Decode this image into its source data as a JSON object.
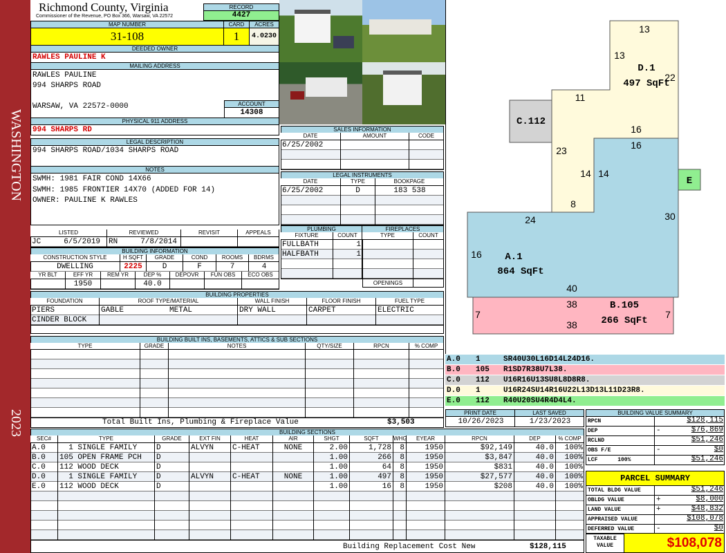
{
  "band": {
    "district": "WASHINGTON",
    "year": "2023"
  },
  "header": {
    "county": "Richmond County, Virginia",
    "subtitle": "Commissioner of the Revenue, PO Box 366, Warsaw, VA 22572",
    "record_label": "RECORD",
    "record": "4427"
  },
  "parcel": {
    "map_label": "MAP NUMBER",
    "map": "31-108",
    "card_label": "CARD",
    "card": "1",
    "acres_label": "ACRES",
    "acres": "4.0230"
  },
  "owner": {
    "label": "DEEDED OWNER",
    "name": "RAWLES PAULINE K"
  },
  "mailing": {
    "label": "MAILING ADDRESS",
    "line1": "RAWLES PAULINE",
    "line2": "994 SHARPS ROAD",
    "line3": "WARSAW, VA 22572-0000",
    "account_label": "ACCOUNT",
    "account": "14308"
  },
  "physical": {
    "label": "PHYSICAL 911 ADDRESS",
    "value": "994 SHARPS RD"
  },
  "legal": {
    "label": "LEGAL DESCRIPTION",
    "value": "994 SHARPS ROAD/1034 SHARPS ROAD"
  },
  "notes": {
    "label": "NOTES",
    "lines": [
      "SWMH: 1981 FAIR COND 14X66",
      "SWMH: 1985 FRONTIER 14X70 (ADDED FOR 14)",
      "OWNER: PAULINE K RAWLES"
    ]
  },
  "review": {
    "headers": [
      "LISTED",
      "REVIEWED",
      "REVISIT",
      "APPEALS"
    ],
    "rows": [
      [
        "JC     6/5/2019",
        "RN     7/8/2014",
        "",
        ""
      ]
    ]
  },
  "building_info": {
    "label": "BUILDING INFORMATION",
    "headers1": [
      "CONSTRUCTION STYLE",
      "H SQFT",
      "GRADE",
      "COND",
      "ROOMS",
      "BDRMS"
    ],
    "row1": [
      [
        "DWELLING",
        "2225",
        "D",
        "F",
        "7",
        "4"
      ]
    ],
    "headers2": [
      "YR BLT",
      "EFF YR",
      "REM YR",
      "DEP %",
      "DEPOVR",
      "FUN OBS",
      "ECO OBS"
    ],
    "row2": [
      [
        "",
        "1950",
        "",
        "40.0",
        "",
        "",
        ""
      ]
    ]
  },
  "sales": {
    "label": "SALES INFORMATION",
    "headers": [
      "DATE",
      "AMOUNT",
      "CODE"
    ],
    "rows": [
      [
        "6/25/2002",
        "",
        ""
      ],
      [
        "",
        "",
        ""
      ],
      [
        "",
        "",
        ""
      ]
    ]
  },
  "instruments": {
    "label": "LEGAL INSTRUMENTS",
    "headers": [
      "DATE",
      "TYPE",
      "BOOKPAGE"
    ],
    "rows": [
      [
        "6/25/2002",
        "D",
        "183 538"
      ],
      [
        "",
        "",
        ""
      ],
      [
        "",
        "",
        ""
      ],
      [
        "",
        "",
        ""
      ]
    ]
  },
  "plumbing": {
    "label": "PLUMBING",
    "headers": [
      "FIXTURE",
      "COUNT"
    ],
    "rows": [
      [
        "FULLBATH",
        "1"
      ],
      [
        "HALFBATH",
        "1"
      ],
      [
        "",
        ""
      ],
      [
        "",
        ""
      ]
    ]
  },
  "fireplaces": {
    "label": "FIREPLACES",
    "headers": [
      "TYPE",
      "COUNT"
    ],
    "rows": [
      [
        "",
        ""
      ],
      [
        "",
        ""
      ],
      [
        "",
        ""
      ],
      [
        "",
        ""
      ]
    ],
    "openings_label": "OPENINGS"
  },
  "properties": {
    "label": "BUILDING PROPERTIES",
    "headers": [
      "FOUNDATION",
      "ROOF TYPE/MATERIAL",
      "WALL FINISH",
      "FLOOR FINISH",
      "FUEL TYPE"
    ],
    "rows": [
      [
        "PIERS",
        "GABLE          METAL",
        "DRY WALL",
        "CARPET",
        "ELECTRIC"
      ],
      [
        "CINDER BLOCK",
        "",
        "",
        "",
        ""
      ]
    ]
  },
  "builtins": {
    "label": "BUILDING BUILT INS, BASEMENTS, ATTICS & SUB SECTIONS",
    "headers": [
      "TYPE",
      "GRADE",
      "NOTES",
      "QTY/SIZE",
      "RPCN",
      "% COMP"
    ],
    "rows": [
      [
        "",
        "",
        "",
        "",
        "",
        ""
      ],
      [
        "",
        "",
        "",
        "",
        "",
        ""
      ],
      [
        "",
        "",
        "",
        "",
        "",
        ""
      ],
      [
        "",
        "",
        "",
        "",
        "",
        ""
      ],
      [
        "",
        "",
        "",
        "",
        "",
        ""
      ],
      [
        "",
        "",
        "",
        "",
        "",
        ""
      ],
      [
        "",
        "",
        "",
        "",
        "",
        ""
      ]
    ],
    "total_label": "Total Built Ins, Plumbing & Fireplace Value",
    "total": "$3,503"
  },
  "sections": {
    "label": "BUILDING SECTIONS",
    "headers": [
      "SEC#",
      "TYPE",
      "GRADE",
      "EXT FIN",
      "HEAT",
      "AIR",
      "SHGT",
      "SQFT",
      "WHGT",
      "EYEAR",
      "RPCN",
      "DEP",
      "% COMP"
    ],
    "rows": [
      [
        "A.0",
        "  1 SINGLE FAMILY",
        "D",
        "ALVYN",
        "C-HEAT",
        "NONE",
        "2.00",
        "1,728",
        "8",
        "1950",
        "$92,149",
        "40.0",
        "100%"
      ],
      [
        "B.0",
        "105 OPEN FRAME PCH",
        "D",
        "",
        "",
        "",
        "1.00",
        "266",
        "8",
        "1950",
        "$3,847",
        "40.0",
        "100%"
      ],
      [
        "C.0",
        "112 WOOD DECK",
        "D",
        "",
        "",
        "",
        "1.00",
        "64",
        "8",
        "1950",
        "$831",
        "40.0",
        "100%"
      ],
      [
        "D.0",
        "  1 SINGLE FAMILY",
        "D",
        "ALVYN",
        "C-HEAT",
        "NONE",
        "1.00",
        "497",
        "8",
        "1950",
        "$27,577",
        "40.0",
        "100%"
      ],
      [
        "E.0",
        "112 WOOD DECK",
        "D",
        "",
        "",
        "",
        "1.00",
        "16",
        "8",
        "1950",
        "$208",
        "40.0",
        "100%"
      ],
      [
        "",
        "",
        "",
        "",
        "",
        "",
        "",
        "",
        "",
        "",
        "",
        "",
        ""
      ],
      [
        "",
        "",
        "",
        "",
        "",
        "",
        "",
        "",
        "",
        "",
        "",
        "",
        ""
      ],
      [
        "",
        "",
        "",
        "",
        "",
        "",
        "",
        "",
        "",
        "",
        "",
        "",
        ""
      ],
      [
        "",
        "",
        "",
        "",
        "",
        "",
        "",
        "",
        "",
        "",
        "",
        "",
        ""
      ],
      [
        "",
        "",
        "",
        "",
        "",
        "",
        "",
        "",
        "",
        "",
        "",
        "",
        ""
      ]
    ],
    "total_label": "Building Replacement Cost New",
    "total": "$128,115"
  },
  "sketch": {
    "A": {
      "name": "A.1",
      "area": "864 SqFt",
      "dims": [
        "16",
        "14",
        "24",
        "30",
        "16",
        "40"
      ]
    },
    "B": {
      "name": "B.105",
      "area": "266 SqFt",
      "dims": [
        "38",
        "38",
        "7",
        "7"
      ]
    },
    "C": {
      "name": "C.112"
    },
    "D": {
      "name": "D.1",
      "area": "497 SqFt",
      "dims": [
        "13",
        "13",
        "22",
        "11",
        "16",
        "23",
        "14",
        "8"
      ]
    },
    "E": {
      "name": "E"
    },
    "colors": {
      "A": "#add8e6",
      "B": "#ffb6c1",
      "C": "#d3d3d3",
      "D": "#fffadc",
      "E": "#90ee90"
    }
  },
  "codes": [
    [
      "A.0",
      "1",
      "SR40U30L16D14L24D16."
    ],
    [
      "B.0",
      "105",
      "R1SD7R38U7L38."
    ],
    [
      "C.0",
      "112",
      "U16R16U13SU8L8D8R8."
    ],
    [
      "D.0",
      "1",
      "U16R24SU14R16U22L13D13L11D23R8."
    ],
    [
      "E.0",
      "112",
      "R40U20SU4R4D4L4."
    ]
  ],
  "dates": {
    "print_label": "PRINT DATE",
    "print": "10/26/2023",
    "saved_label": "LAST SAVED",
    "saved": "1/23/2023"
  },
  "value_summary": {
    "label": "BUILDING VALUE SUMMARY",
    "rows": [
      [
        "RPCN",
        "",
        "$128,115"
      ],
      [
        "DEP",
        "-",
        "$76,869"
      ],
      [
        "RCLND",
        "",
        "$51,246"
      ],
      [
        "OBS F/E",
        "-",
        "$0"
      ],
      [
        "LCF      100%",
        "",
        "$51,246"
      ]
    ]
  },
  "parcel_summary": {
    "label": "PARCEL SUMMARY",
    "rows": [
      [
        "TOTAL BLDG VALUE",
        "",
        "$51,246"
      ],
      [
        "OBLDG VALUE",
        "+",
        "$8,000"
      ],
      [
        "LAND VALUE",
        "+",
        "$48,832"
      ],
      [
        "APPRAISED VALUE",
        "",
        "$108,078"
      ],
      [
        "DEFERRED VALUE",
        "-",
        "$0"
      ]
    ],
    "taxable_label": "TAXABLE\nVALUE",
    "taxable": "$108,078"
  }
}
